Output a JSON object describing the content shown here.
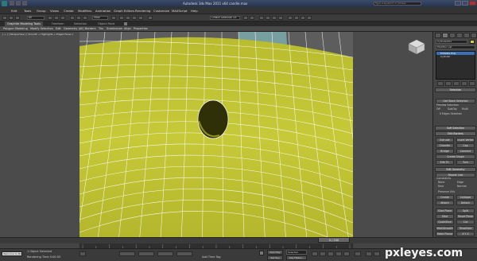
{
  "titlebar": {
    "title": "Autodesk 3ds Max 2011 x64      candle.max",
    "app_icon": "3ds-max-logo-icon"
  },
  "menubar": {
    "items": [
      "Edit",
      "Tools",
      "Group",
      "Views",
      "Create",
      "Modifiers",
      "Animation",
      "Graph Editors",
      "Rendering",
      "Customize",
      "MAXScript",
      "Help"
    ],
    "search_placeholder": "Type a keyword or phrase"
  },
  "toolbar": {
    "selection_filter": "All",
    "view_dropdown": "View",
    "named_sel": "Create Selection Se"
  },
  "ribbon_tabs": [
    "Graphite Modeling Tools",
    "Freeform",
    "Selection",
    "Object Paint"
  ],
  "ribbon_items": [
    "Polygon Modeling",
    "Modify Selection",
    "Edit",
    "Geometry (All)",
    "Borders",
    "Tris",
    "Subdivision",
    "Align",
    "Properties"
  ],
  "viewport": {
    "label": "[ + ] [ Perspective ] [ Smooth + Highlights + Edged Faces ]",
    "surface_color": "#c9cc3a",
    "edge_color": "#ffffff"
  },
  "cmdpanel": {
    "object_name": "Cylinder001",
    "modifier_list": "Modifier List",
    "stack": [
      "Editable Poly",
      "Cylinder"
    ],
    "selection_header": "Selection",
    "soft_sel_btn": "Get Stack Selection",
    "preview_label": "Preview Selection",
    "preview_options": [
      "Off",
      "SubObj",
      "Multi"
    ],
    "selected_text": "0 Edges Selected",
    "soft_selection": "Soft Selection",
    "edit_borders": "Edit Borders",
    "extrude": "Extrude",
    "insert_vertex": "Insert Vertex",
    "chamfer": "Chamfer",
    "cap": "Cap",
    "bridge": "Bridge",
    "connect": "Connect",
    "create_shape": "Create Shape",
    "edit_tri": "Edit Tri.",
    "turn": "Turn",
    "edit_geometry": "Edit Geometry",
    "repeat_last": "Repeat Last",
    "constraints": "Constraints",
    "none": "None",
    "edge": "Edge",
    "face": "Face",
    "normal": "Normal",
    "preserve_uvs": "Preserve UVs",
    "create": "Create",
    "collapse": "Collapse",
    "attach": "Attach",
    "detach": "Detach",
    "slice_plane": "Slice Plane",
    "split": "Split",
    "slice": "Slice",
    "reset_plane": "Reset Plane",
    "quickslice": "QuickSlice",
    "cut": "Cut",
    "meshsmooth": "MeshSmooth",
    "tessellate": "Tessellate",
    "make_planar": "Make Planar",
    "xyz": "X Y Z",
    "view_align": "View Align",
    "grid_align": "Grid Align"
  },
  "timeline": {
    "frame": "0 / 100"
  },
  "statusbar": {
    "selected": "1 Object Selected",
    "prompt": "Rendering Time 0:00:03",
    "welcome": "Welcome to MA",
    "add_time_tag": "Add Time Tag",
    "auto_key": "Auto Key",
    "set_key": "Set Key",
    "key_filters": "Key Filters...",
    "selected_dd": "Selected"
  },
  "watermark": {
    "text": "pxleyes.com"
  }
}
